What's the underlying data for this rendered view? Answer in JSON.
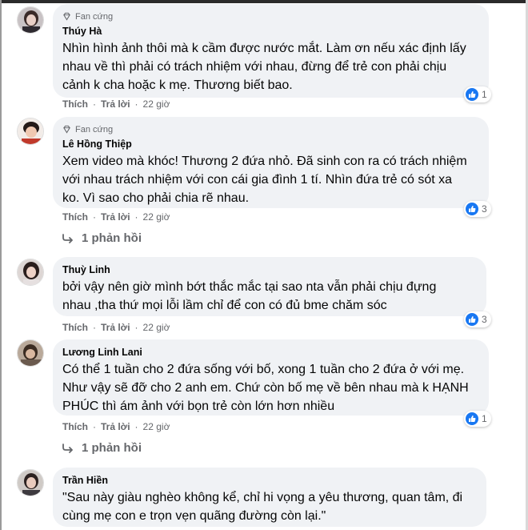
{
  "comments": [
    {
      "badge": "Fan cứng",
      "author": "Thúy Hà",
      "lines": [
        "Nhìn hình ảnh thôi mà k cầm được nước mắt. Làm ơn nếu xác định lấy",
        "nhau về thì phải có trách nhiệm với nhau, đừng để trẻ con phải chịu",
        "cảnh k cha hoặc k mẹ. Thương biết bao."
      ],
      "actions": {
        "like": "Thích",
        "reply": "Trả lời",
        "time": "22 giờ"
      },
      "reaction_count": "1"
    },
    {
      "badge": "Fan cứng",
      "author": "Lê Hồng Thiệp",
      "lines": [
        "Xem video mà khóc! Thương 2 đứa nhỏ. Đã sinh con ra có trách nhiệm",
        "với nhau trách nhiệm với con cái gia đình 1 tí. Nhìn đứa trẻ có sót xa",
        "ko. Vì sao cho phải chia rẽ nhau."
      ],
      "actions": {
        "like": "Thích",
        "reply": "Trả lời",
        "time": "22 giờ"
      },
      "reaction_count": "3",
      "replies": "1 phản hồi"
    },
    {
      "author": "Thuỳ Linh",
      "lines": [
        "bởi vậy nên giờ mình bớt thắc mắc tại sao nta vẫn phải chịu đựng",
        "nhau ,tha thứ mọi lỗi lầm chỉ để con có đủ bme chăm sóc"
      ],
      "actions": {
        "like": "Thích",
        "reply": "Trả lời",
        "time": "22 giờ"
      },
      "reaction_count": "3"
    },
    {
      "author": "Lương Linh Lani",
      "lines": [
        "Có thể 1 tuần cho 2 đứa sống với bố, xong 1 tuần cho 2 đứa ở với mẹ.",
        "Như vậy sẽ đỡ cho 2 anh em. Chứ còn bố mẹ về bên nhau mà k HẠNH",
        "PHÚC thì ám ảnh với bọn trẻ còn lớn hơn nhiều"
      ],
      "actions": {
        "like": "Thích",
        "reply": "Trả lời",
        "time": "22 giờ"
      },
      "reaction_count": "1",
      "replies": "1 phản hồi"
    },
    {
      "author": "Trần Hiền",
      "lines": [
        "\"Sau này giàu nghèo không kể, chỉ hi vọng a yêu thương, quan tâm, đi",
        "cùng mẹ con e trọn vẹn quãng đường còn lại.\""
      ]
    }
  ],
  "colors": {
    "bubble": "#f0f2f5",
    "like_blue": "#1877f2",
    "secondary_text": "#65676b"
  },
  "icons": [
    "diamond-icon",
    "like-icon",
    "reply-arrow-icon"
  ]
}
